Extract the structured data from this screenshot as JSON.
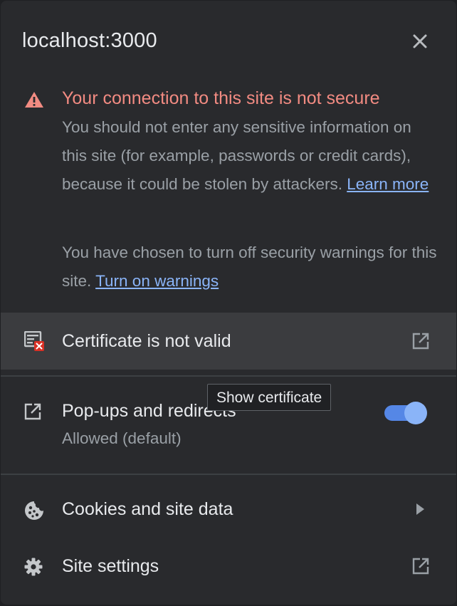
{
  "header": {
    "title": "localhost:3000",
    "close_icon": "close-icon"
  },
  "warning": {
    "icon": "warning-triangle-icon",
    "title": "Your connection to this site is not secure",
    "body": "You should not enter any sensitive information on this site (for example, passwords or credit cards), because it could be stolen by attackers.",
    "learn_more": "Learn more",
    "warnings_text": "You have chosen to turn off security warnings for this site.",
    "turn_on_warnings": "Turn on warnings",
    "title_color": "#f28b82"
  },
  "certificate": {
    "icon": "invalid-certificate-icon",
    "label": "Certificate is not valid",
    "action_icon": "external-link-icon",
    "tooltip": "Show certificate"
  },
  "popups": {
    "icon": "external-link-icon",
    "label": "Pop-ups and redirects",
    "status": "Allowed (default)",
    "toggle_on": true,
    "accent_color": "#8ab4f8"
  },
  "cookies": {
    "icon": "cookie-icon",
    "label": "Cookies and site data",
    "action_icon": "chevron-right-icon"
  },
  "site_settings": {
    "icon": "gear-icon",
    "label": "Site settings",
    "action_icon": "external-link-icon"
  }
}
